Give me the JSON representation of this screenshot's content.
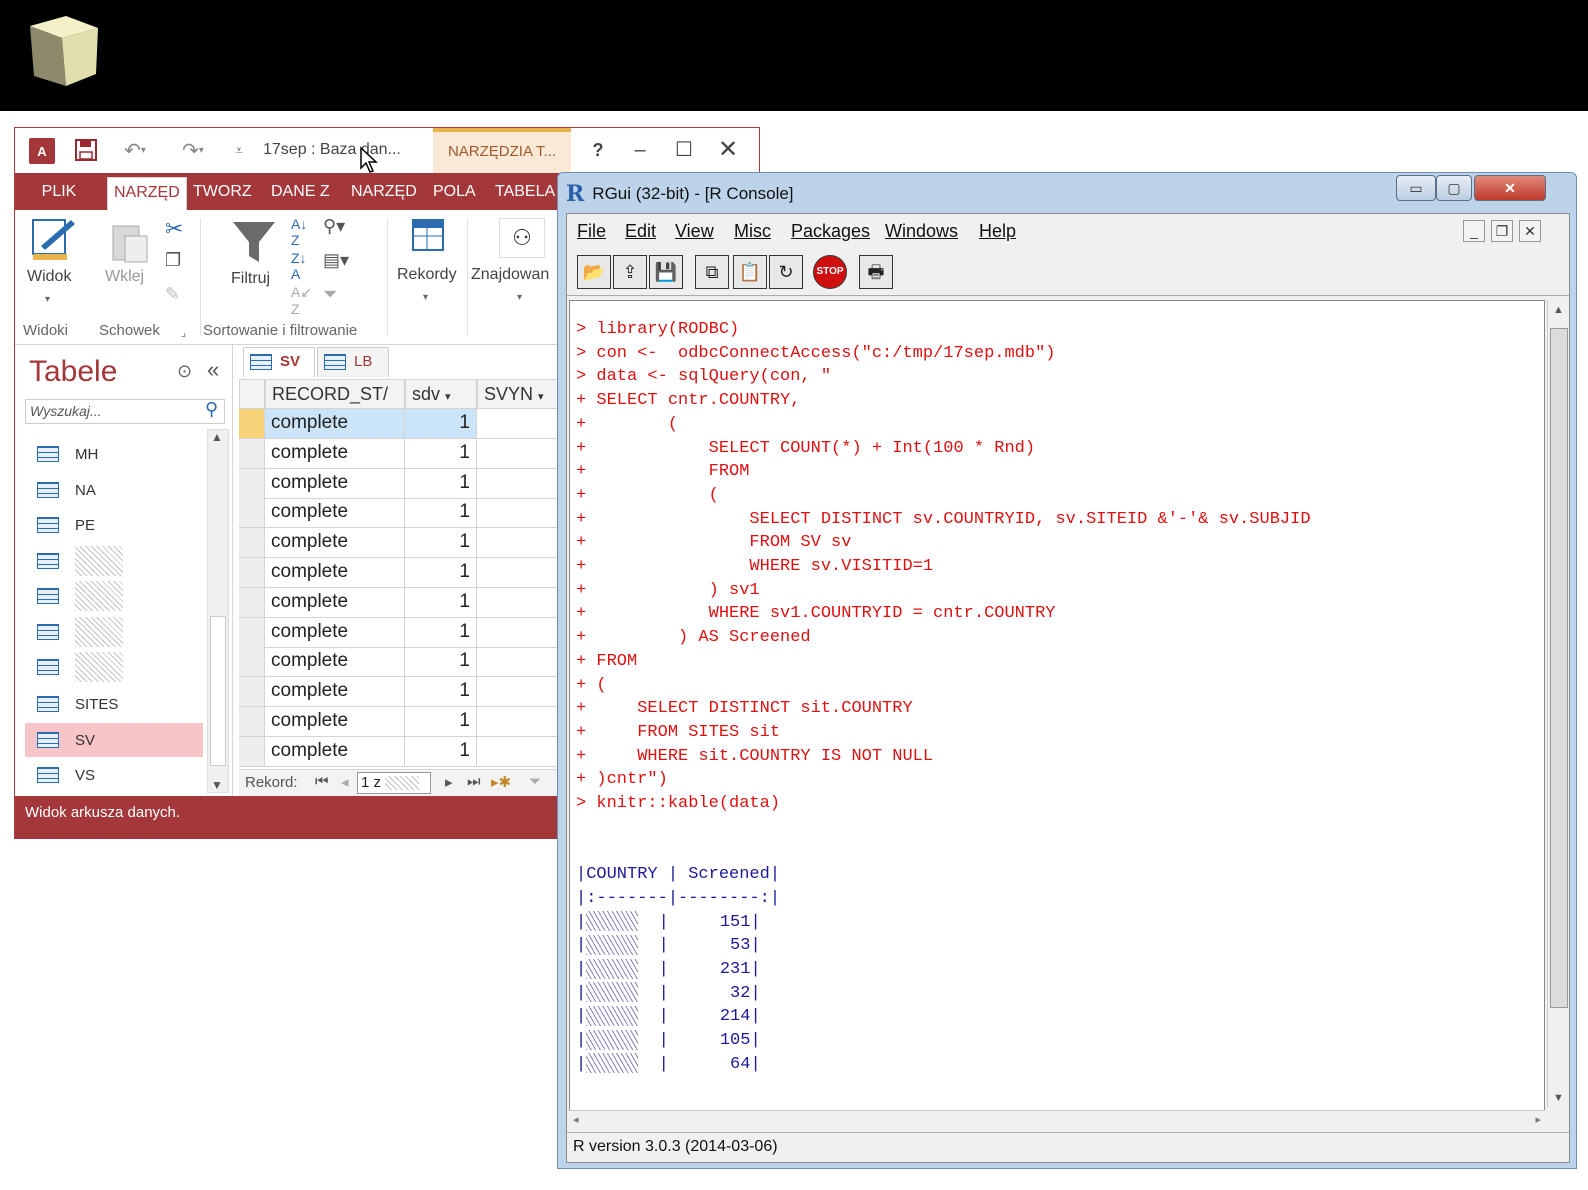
{
  "access": {
    "title": "17sep : Baza dan...",
    "tools_tab": "NARZĘDZIA T...",
    "help": "?",
    "ribbon_tabs": [
      "PLIK",
      "NARZĘD",
      "TWORZ",
      "DANE Z",
      "NARZĘD",
      "POLA",
      "TABELA"
    ],
    "ribbon": {
      "widok": "Widok",
      "wklej": "Wklej",
      "filtruj": "Filtruj",
      "rekordy": "Rekordy",
      "znajdowanie": "Znajdowan",
      "group_widoki": "Widoki",
      "group_schowek": "Schowek",
      "group_sort": "Sortowanie i filtrowanie"
    },
    "nav": {
      "title": "Tabele",
      "search_placeholder": "Wyszukaj...",
      "items": [
        "MH",
        "NA",
        "PE",
        "",
        "",
        "",
        "",
        "SITES",
        "SV",
        "VS"
      ]
    },
    "doc_tabs": [
      "SV",
      "LB"
    ],
    "columns": [
      "RECORD_ST/",
      "sdv",
      "SVYN"
    ],
    "rows": [
      {
        "status": "complete",
        "sdv": "1"
      },
      {
        "status": "complete",
        "sdv": "1"
      },
      {
        "status": "complete",
        "sdv": "1"
      },
      {
        "status": "complete",
        "sdv": "1"
      },
      {
        "status": "complete",
        "sdv": "1"
      },
      {
        "status": "complete",
        "sdv": "1"
      },
      {
        "status": "complete",
        "sdv": "1"
      },
      {
        "status": "complete",
        "sdv": "1"
      },
      {
        "status": "complete",
        "sdv": "1"
      },
      {
        "status": "complete",
        "sdv": "1"
      },
      {
        "status": "complete",
        "sdv": "1"
      },
      {
        "status": "complete",
        "sdv": "1"
      }
    ],
    "record_label": "Rekord:",
    "record_value": "1 z",
    "status_text": "Widok arkusza danych."
  },
  "rgui": {
    "title": "RGui (32-bit) - [R Console]",
    "menus": [
      "File",
      "Edit",
      "View",
      "Misc",
      "Packages",
      "Windows",
      "Help"
    ],
    "console_lines": [
      "> library(RODBC)",
      "> con <-  odbcConnectAccess(\"c:/tmp/17sep.mdb\")",
      "> data <- sqlQuery(con, \"",
      "+ SELECT cntr.COUNTRY,",
      "+        (",
      "+            SELECT COUNT(*) + Int(100 * Rnd)",
      "+            FROM",
      "+            (",
      "+                SELECT DISTINCT sv.COUNTRYID, sv.SITEID &'-'& sv.SUBJID",
      "+                FROM SV sv",
      "+                WHERE sv.VISITID=1",
      "+            ) sv1",
      "+            WHERE sv1.COUNTRYID = cntr.COUNTRY",
      "+         ) AS Screened",
      "+ FROM",
      "+ (",
      "+     SELECT DISTINCT sit.COUNTRY",
      "+     FROM SITES sit",
      "+     WHERE sit.COUNTRY IS NOT NULL",
      "+ )cntr\")",
      "> knitr::kable(data)"
    ],
    "table_header": "|COUNTRY | Screened|",
    "table_rule": "|:-------|--------:|",
    "table_values": [
      "151",
      "53",
      "231",
      "32",
      "214",
      "105",
      "64"
    ],
    "status": "R version 3.0.3 (2014-03-06)"
  }
}
